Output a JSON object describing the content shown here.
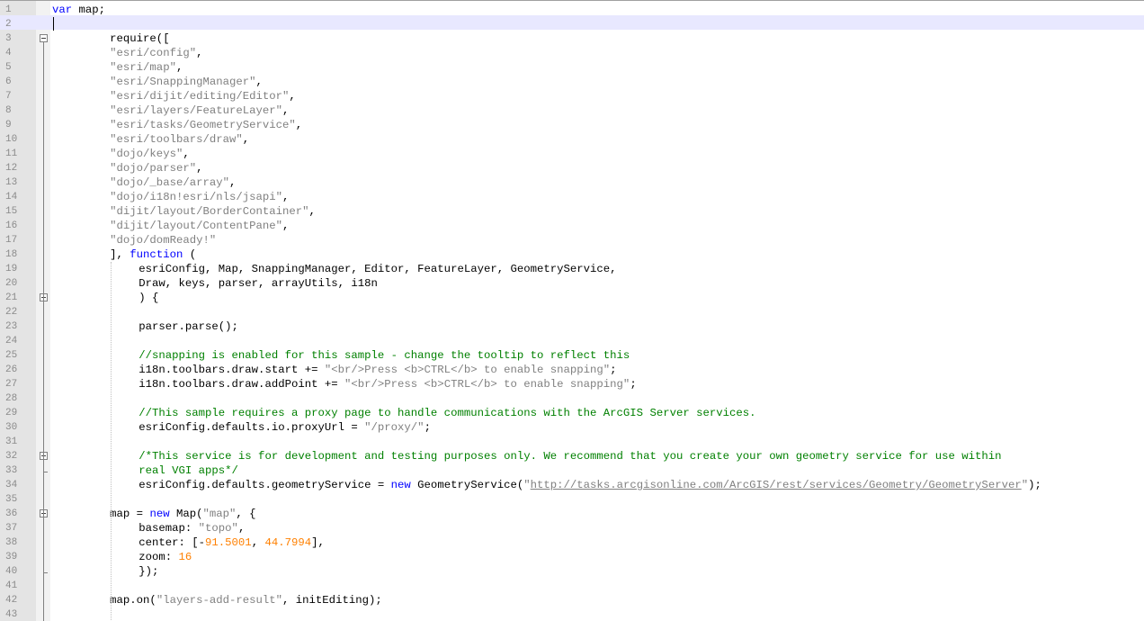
{
  "editor": {
    "lines": [
      {
        "n": "1",
        "indent": 0,
        "tokens": [
          [
            "kw",
            "var"
          ],
          [
            "p",
            " map;"
          ]
        ]
      },
      {
        "n": "2",
        "indent": 0,
        "tokens": []
      },
      {
        "n": "3",
        "indent": 8,
        "tokens": [
          [
            "p",
            "require(["
          ]
        ]
      },
      {
        "n": "4",
        "indent": 8,
        "tokens": [
          [
            "str",
            "\"esri/config\""
          ],
          [
            "p",
            ","
          ]
        ]
      },
      {
        "n": "5",
        "indent": 8,
        "tokens": [
          [
            "str",
            "\"esri/map\""
          ],
          [
            "p",
            ","
          ]
        ]
      },
      {
        "n": "6",
        "indent": 8,
        "tokens": [
          [
            "str",
            "\"esri/SnappingManager\""
          ],
          [
            "p",
            ","
          ]
        ]
      },
      {
        "n": "7",
        "indent": 8,
        "tokens": [
          [
            "str",
            "\"esri/dijit/editing/Editor\""
          ],
          [
            "p",
            ","
          ]
        ]
      },
      {
        "n": "8",
        "indent": 8,
        "tokens": [
          [
            "str",
            "\"esri/layers/FeatureLayer\""
          ],
          [
            "p",
            ","
          ]
        ]
      },
      {
        "n": "9",
        "indent": 8,
        "tokens": [
          [
            "str",
            "\"esri/tasks/GeometryService\""
          ],
          [
            "p",
            ","
          ]
        ]
      },
      {
        "n": "10",
        "indent": 8,
        "tokens": [
          [
            "str",
            "\"esri/toolbars/draw\""
          ],
          [
            "p",
            ","
          ]
        ]
      },
      {
        "n": "11",
        "indent": 8,
        "tokens": [
          [
            "str",
            "\"dojo/keys\""
          ],
          [
            "p",
            ","
          ]
        ]
      },
      {
        "n": "12",
        "indent": 8,
        "tokens": [
          [
            "str",
            "\"dojo/parser\""
          ],
          [
            "p",
            ","
          ]
        ]
      },
      {
        "n": "13",
        "indent": 8,
        "tokens": [
          [
            "str",
            "\"dojo/_base/array\""
          ],
          [
            "p",
            ","
          ]
        ]
      },
      {
        "n": "14",
        "indent": 8,
        "tokens": [
          [
            "str",
            "\"dojo/i18n!esri/nls/jsapi\""
          ],
          [
            "p",
            ","
          ]
        ]
      },
      {
        "n": "15",
        "indent": 8,
        "tokens": [
          [
            "str",
            "\"dijit/layout/BorderContainer\""
          ],
          [
            "p",
            ","
          ]
        ]
      },
      {
        "n": "16",
        "indent": 8,
        "tokens": [
          [
            "str",
            "\"dijit/layout/ContentPane\""
          ],
          [
            "p",
            ","
          ]
        ]
      },
      {
        "n": "17",
        "indent": 8,
        "tokens": [
          [
            "str",
            "\"dojo/domReady!\""
          ]
        ]
      },
      {
        "n": "18",
        "indent": 8,
        "tokens": [
          [
            "p",
            "], "
          ],
          [
            "kw",
            "function"
          ],
          [
            "p",
            " ("
          ]
        ]
      },
      {
        "n": "19",
        "indent": 12,
        "tokens": [
          [
            "p",
            "esriConfig, Map, SnappingManager, Editor, FeatureLayer, GeometryService,"
          ]
        ]
      },
      {
        "n": "20",
        "indent": 12,
        "tokens": [
          [
            "p",
            "Draw, keys, parser, arrayUtils, i18n"
          ]
        ]
      },
      {
        "n": "21",
        "indent": 12,
        "tokens": [
          [
            "p",
            ") {"
          ]
        ]
      },
      {
        "n": "22",
        "indent": 0,
        "tokens": []
      },
      {
        "n": "23",
        "indent": 12,
        "tokens": [
          [
            "p",
            "parser.parse();"
          ]
        ]
      },
      {
        "n": "24",
        "indent": 0,
        "tokens": []
      },
      {
        "n": "25",
        "indent": 12,
        "tokens": [
          [
            "com",
            "//snapping is enabled for this sample - change the tooltip to reflect this"
          ]
        ]
      },
      {
        "n": "26",
        "indent": 12,
        "tokens": [
          [
            "p",
            "i18n.toolbars.draw.start += "
          ],
          [
            "str",
            "\"<br/>Press <b>CTRL</b> to enable snapping\""
          ],
          [
            "p",
            ";"
          ]
        ]
      },
      {
        "n": "27",
        "indent": 12,
        "tokens": [
          [
            "p",
            "i18n.toolbars.draw.addPoint += "
          ],
          [
            "str",
            "\"<br/>Press <b>CTRL</b> to enable snapping\""
          ],
          [
            "p",
            ";"
          ]
        ]
      },
      {
        "n": "28",
        "indent": 0,
        "tokens": []
      },
      {
        "n": "29",
        "indent": 12,
        "tokens": [
          [
            "com",
            "//This sample requires a proxy page to handle communications with the ArcGIS Server services."
          ]
        ]
      },
      {
        "n": "30",
        "indent": 12,
        "tokens": [
          [
            "p",
            "esriConfig.defaults.io.proxyUrl = "
          ],
          [
            "str",
            "\"/proxy/\""
          ],
          [
            "p",
            ";"
          ]
        ]
      },
      {
        "n": "31",
        "indent": 0,
        "tokens": []
      },
      {
        "n": "32",
        "indent": 12,
        "tokens": [
          [
            "com",
            "/*This service is for development and testing purposes only. We recommend that you create your own geometry service for use within"
          ]
        ]
      },
      {
        "n": "33",
        "indent": 12,
        "tokens": [
          [
            "com",
            "real VGI apps*/"
          ]
        ]
      },
      {
        "n": "34",
        "indent": 12,
        "tokens": [
          [
            "p",
            "esriConfig.defaults.geometryService = "
          ],
          [
            "kw",
            "new"
          ],
          [
            "p",
            " GeometryService("
          ],
          [
            "str",
            "\""
          ],
          [
            "url",
            "http://tasks.arcgisonline.com/ArcGIS/rest/services/Geometry/GeometryServer"
          ],
          [
            "str",
            "\""
          ],
          [
            "p",
            ");"
          ]
        ]
      },
      {
        "n": "35",
        "indent": 0,
        "tokens": []
      },
      {
        "n": "36",
        "indent": 8,
        "tokens": [
          [
            "p",
            "map = "
          ],
          [
            "kw",
            "new"
          ],
          [
            "p",
            " Map("
          ],
          [
            "str",
            "\"map\""
          ],
          [
            "p",
            ", {"
          ]
        ]
      },
      {
        "n": "37",
        "indent": 12,
        "tokens": [
          [
            "p",
            "basemap: "
          ],
          [
            "str",
            "\"topo\""
          ],
          [
            "p",
            ","
          ]
        ]
      },
      {
        "n": "38",
        "indent": 12,
        "tokens": [
          [
            "p",
            "center: [-"
          ],
          [
            "num",
            "91.5001"
          ],
          [
            "p",
            ", "
          ],
          [
            "num",
            "44.7994"
          ],
          [
            "p",
            "],"
          ]
        ]
      },
      {
        "n": "39",
        "indent": 12,
        "tokens": [
          [
            "p",
            "zoom: "
          ],
          [
            "num",
            "16"
          ]
        ]
      },
      {
        "n": "40",
        "indent": 12,
        "tokens": [
          [
            "p",
            "});"
          ]
        ]
      },
      {
        "n": "41",
        "indent": 0,
        "tokens": []
      },
      {
        "n": "42",
        "indent": 8,
        "tokens": [
          [
            "p",
            "map.on("
          ],
          [
            "str",
            "\"layers-add-result\""
          ],
          [
            "p",
            ", initEditing);"
          ]
        ]
      },
      {
        "n": "43",
        "indent": 0,
        "tokens": []
      }
    ],
    "current_line": "2",
    "fold_markers": [
      "3",
      "21",
      "32",
      "36"
    ]
  }
}
